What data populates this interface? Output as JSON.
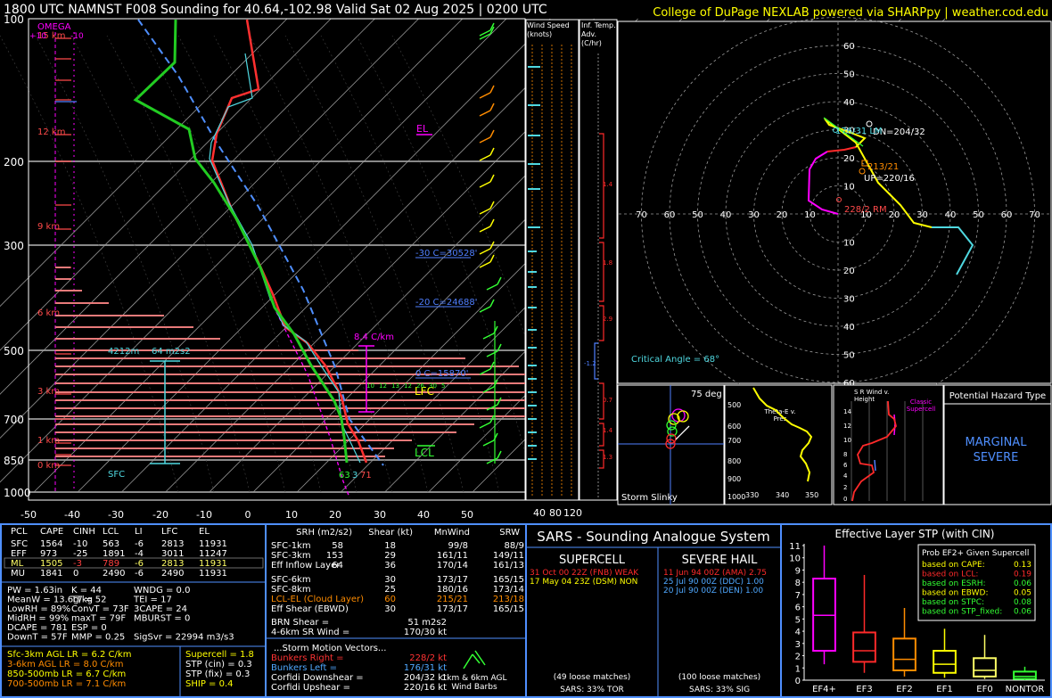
{
  "header": {
    "title": "1800 UTC NAMNST F008 Sounding for 40.64,-102.98 Valid  Sat 02 Aug 2025 | 0200 UTC",
    "credit": "College of DuPage NEXLAB powered via SHARPpy | weather.cod.edu"
  },
  "skewt": {
    "pressure_ticks": [
      "100",
      "200",
      "300",
      "500",
      "700",
      "850",
      "1000"
    ],
    "temp_ticks": [
      "-50",
      "-40",
      "-30",
      "-20",
      "-10",
      "0",
      "10",
      "20",
      "30",
      "40",
      "50"
    ],
    "height_labels": [
      "15 km",
      "12 km",
      "9 km",
      "6 km",
      "3 km",
      "1 km",
      "0 km"
    ],
    "omega_label": "OMEGA",
    "omega_scale": [
      "+10",
      "-10"
    ],
    "el_label": "EL",
    "lfc_label": "LFC",
    "lcl_label": "LCL",
    "isotherm_labels": [
      "-30 C=30528'",
      "-20 C=24688'",
      "0 C=15870'"
    ],
    "lapse_label": "8.4 C/km",
    "inflow_label": "4212m",
    "srh_label": "64 m2s2",
    "sfc_label": "SFC",
    "sfc_values": [
      "63",
      "3",
      "71"
    ],
    "mini_numbers": [
      "10",
      "12",
      "13",
      "12",
      "26",
      "30",
      "5"
    ]
  },
  "panels": {
    "wind_speed_title": "Wind Speed (knots)",
    "wind_speed_ticks": [
      "40",
      "80",
      "120"
    ],
    "temp_adv_title": "Inf. Temp. Adv. (C/hr)",
    "temp_adv_values": [
      "1.4",
      "1.8",
      "2.9",
      "-1.2",
      "0.7",
      "1.4",
      "1.3"
    ]
  },
  "hodograph": {
    "rings": [
      "10",
      "20",
      "30",
      "40",
      "50",
      "60"
    ],
    "x_labels": [
      "70",
      "60",
      "50",
      "40",
      "30",
      "20",
      "10",
      "10",
      "20",
      "30",
      "40",
      "50",
      "60",
      "70"
    ],
    "labels": {
      "dn": "DN=204/32",
      "up": "UP=220/16",
      "lm": "176/31 LM",
      "rm": "228/2 RM",
      "mw": "213/21",
      "critical": "Critical Angle = 68°"
    }
  },
  "small_panels": {
    "slinky_angle": "75 deg",
    "slinky_title": "Storm Slinky",
    "theta_title": "Theta-E v. Pres",
    "theta_y": [
      "500",
      "600",
      "700",
      "800",
      "900",
      "1000"
    ],
    "theta_x": [
      "330",
      "340",
      "350"
    ],
    "srwind_title": "S R Wind v. Height",
    "srwind_y": [
      "14",
      "12",
      "10",
      "8",
      "6",
      "4",
      "2",
      "0"
    ],
    "srwind_x": [
      "0",
      "20",
      "40",
      "60",
      "80"
    ],
    "classic_label": "Classic Supercell",
    "hazard_title": "Potential Hazard Type",
    "hazard_value_1": "MARGINAL",
    "hazard_value_2": "SEVERE"
  },
  "thermo_table": {
    "headers": [
      "PCL",
      "CAPE",
      "CINH",
      "LCL",
      "LI",
      "LFC",
      "EL"
    ],
    "rows": [
      [
        "SFC",
        "1564",
        "-10",
        "563",
        "-6",
        "2813",
        "11931"
      ],
      [
        "EFF",
        "973",
        "-25",
        "1891",
        "-4",
        "3011",
        "11247"
      ],
      [
        "ML",
        "1505",
        "-3",
        "789",
        "-6",
        "2813",
        "11931"
      ],
      [
        "MU",
        "1841",
        "0",
        "2490",
        "-6",
        "2490",
        "11931"
      ]
    ],
    "indices": [
      [
        "PW = 1.63in",
        "K = 44",
        "WNDG = 0.0"
      ],
      [
        "MeanW = 13.6g/kg",
        "TT = 52",
        "TEI = 17"
      ],
      [
        "LowRH = 89%",
        "ConvT = 73F",
        "3CAPE = 24"
      ],
      [
        "MidRH = 99%",
        "maxT = 79F",
        "MBURST = 0"
      ],
      [
        "DCAPE = 781",
        "ESP = 0",
        ""
      ],
      [
        "DownT = 57F",
        "MMP = 0.25",
        "SigSvr = 22994 m3/s3"
      ]
    ],
    "lapse_rates": [
      {
        "text": "Sfc-3km AGL LR = 6.2 C/km",
        "color": "#ffff00"
      },
      {
        "text": "3-6km AGL LR = 8.0 C/km",
        "color": "#ff8c00"
      },
      {
        "text": "850-500mb LR = 6.7 C/km",
        "color": "#ffff00"
      },
      {
        "text": "700-500mb LR = 7.1 C/km",
        "color": "#ff8c00"
      }
    ],
    "composites": [
      {
        "text": "Supercell = 1.8",
        "color": "#ffff00"
      },
      {
        "text": "STP (cin) = 0.3",
        "color": "#ffffff"
      },
      {
        "text": "STP (fix) = 0.3",
        "color": "#ffffff"
      },
      {
        "text": "SHIP = 0.4",
        "color": "#ffff00"
      }
    ]
  },
  "kinematic_table": {
    "headers": [
      "SRH (m2/s2)",
      "Shear (kt)",
      "MnWind",
      "SRW"
    ],
    "rows": [
      [
        "SFC-1km",
        "58",
        "18",
        "99/8",
        "88/9"
      ],
      [
        "SFC-3km",
        "153",
        "29",
        "161/11",
        "149/11"
      ],
      [
        "Eff Inflow Layer",
        "64",
        "36",
        "170/14",
        "161/13"
      ],
      [
        "SFC-6km",
        "30",
        "173/17",
        "165/15",
        ""
      ],
      [
        "SFC-8km",
        "25",
        "180/16",
        "173/14",
        ""
      ],
      [
        "LCL-EL (Cloud Layer)",
        "60",
        "215/21",
        "213/18",
        ""
      ],
      [
        "Eff Shear (EBWD)",
        "30",
        "173/17",
        "165/15",
        ""
      ]
    ],
    "brn_shear": "BRN Shear =",
    "brn_value": "51 m2s2",
    "sr_wind": "4-6km SR Wind =",
    "sr_value": "170/30 kt",
    "storm_motion_title": "...Storm Motion Vectors...",
    "vectors": [
      {
        "label": "Bunkers Right =",
        "value": "228/2 kt",
        "color": "#ff3333"
      },
      {
        "label": "Bunkers Left =",
        "value": "176/31 kt",
        "color": "#4fa8ff"
      },
      {
        "label": "Corfidi Downshear =",
        "value": "204/32 kt",
        "color": "#ffffff"
      },
      {
        "label": "Corfidi Upshear =",
        "value": "220/16 kt",
        "color": "#ffffff"
      }
    ],
    "barb_caption_1": "1km & 6km AGL",
    "barb_caption_2": "Wind Barbs"
  },
  "sars": {
    "title": "SARS - Sounding Analogue System",
    "supercell_title": "SUPERCELL",
    "supercell_matches": [
      {
        "text": "31 Oct 00 22Z (FNB)  WEAK",
        "color": "#ff2a2a"
      },
      {
        "text": "17 May 04 23Z (DSM) NON",
        "color": "#ffff00"
      }
    ],
    "supercell_loose": "(49 loose matches)",
    "supercell_prob": "SARS: 33% TOR",
    "hail_title": "SEVERE HAIL",
    "hail_matches": [
      {
        "text": "11 Jun 94 00Z (AMA)  2.75",
        "color": "#ff2a2a"
      },
      {
        "text": "25 Jul 90 00Z (DDC)  1.00",
        "color": "#4fa8ff"
      },
      {
        "text": "20 Jul 90 00Z (DEN)  1.00",
        "color": "#4fa8ff"
      }
    ],
    "hail_loose": "(100 loose matches)",
    "hail_prob": "SARS: 33% SIG"
  },
  "stp": {
    "title": "Effective Layer STP (with CIN)",
    "legend_title": "Prob EF2+ Given Supercell",
    "legend_rows": [
      {
        "label": "based on CAPE:",
        "value": "0.13"
      },
      {
        "label": "based on LCL:",
        "value": "0.19"
      },
      {
        "label": "based on ESRH:",
        "value": "0.06"
      },
      {
        "label": "based on EBWD:",
        "value": "0.05"
      },
      {
        "label": "based on STPC:",
        "value": "0.08"
      },
      {
        "label": "based on STP_fixed:",
        "value": "0.06"
      }
    ],
    "y_ticks": [
      "0",
      "1",
      "2",
      "3",
      "4",
      "5",
      "6",
      "7",
      "8",
      "9",
      "10",
      "11"
    ],
    "categories": [
      "EF4+",
      "EF3",
      "EF2",
      "EF1",
      "EF0",
      "NONTOR"
    ]
  },
  "chart_data": {
    "type": "box",
    "title": "Effective Layer STP (with CIN)",
    "categories": [
      "EF4+",
      "EF3",
      "EF2",
      "EF1",
      "EF0",
      "NONTOR"
    ],
    "series": [
      {
        "category": "EF4+",
        "whisker_low": 1.3,
        "q1": 2.4,
        "median": 5.3,
        "q3": 8.3,
        "whisker_high": 11.0
      },
      {
        "category": "EF3",
        "whisker_low": 0.6,
        "q1": 1.5,
        "median": 2.4,
        "q3": 3.9,
        "whisker_high": 8.6
      },
      {
        "category": "EF2",
        "whisker_low": 0.3,
        "q1": 0.8,
        "median": 1.7,
        "q3": 3.4,
        "whisker_high": 5.9
      },
      {
        "category": "EF1",
        "whisker_low": 0.2,
        "q1": 0.6,
        "median": 1.3,
        "q3": 2.4,
        "whisker_high": 4.2
      },
      {
        "category": "EF0",
        "whisker_low": 0.1,
        "q1": 0.3,
        "median": 0.8,
        "q3": 1.8,
        "whisker_high": 3.7
      },
      {
        "category": "NONTOR",
        "whisker_low": 0.0,
        "q1": 0.1,
        "median": 0.3,
        "q3": 0.7,
        "whisker_high": 1.1
      }
    ],
    "colors": [
      "#ff00ff",
      "#ff2a2a",
      "#ff8c00",
      "#ffff00",
      "#ffff66",
      "#33ff33"
    ],
    "ylim": [
      0,
      11
    ]
  }
}
